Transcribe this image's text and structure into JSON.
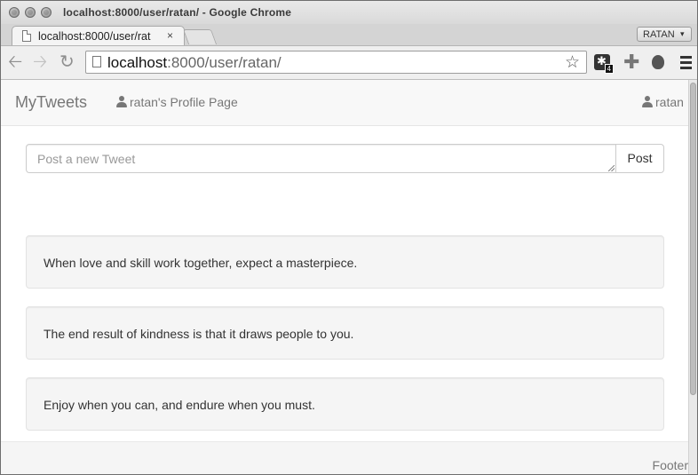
{
  "window": {
    "title": "localhost:8000/user/ratan/ - Google Chrome"
  },
  "tabs": [
    {
      "label": "localhost:8000/user/rat",
      "close": "×"
    }
  ],
  "profile_button": {
    "label": "RATAN",
    "arrow": "▾"
  },
  "toolbar": {
    "url_host": "localhost",
    "url_rest": ":8000/user/ratan/",
    "extension_badge": "4",
    "icons": [
      "back-icon",
      "forward-icon",
      "reload-icon",
      "page-icon",
      "star-icon",
      "extension-icon",
      "puzzle-icon",
      "fingerprint-icon",
      "menu-icon"
    ]
  },
  "navbar": {
    "brand": "MyTweets",
    "profile_link": "ratan's Profile Page",
    "user": "ratan"
  },
  "composer": {
    "placeholder": "Post a new Tweet",
    "post_label": "Post"
  },
  "tweets": [
    {
      "text": "When love and skill work together, expect a masterpiece."
    },
    {
      "text": "The end result of kindness is that it draws people to you."
    },
    {
      "text": "Enjoy when you can, and endure when you must."
    }
  ],
  "footer": {
    "text": "Footer"
  },
  "colors": {
    "navbar_bg": "#f8f8f8",
    "well_bg": "#f5f5f5",
    "link_text": "#777777",
    "body_text": "#333333"
  }
}
